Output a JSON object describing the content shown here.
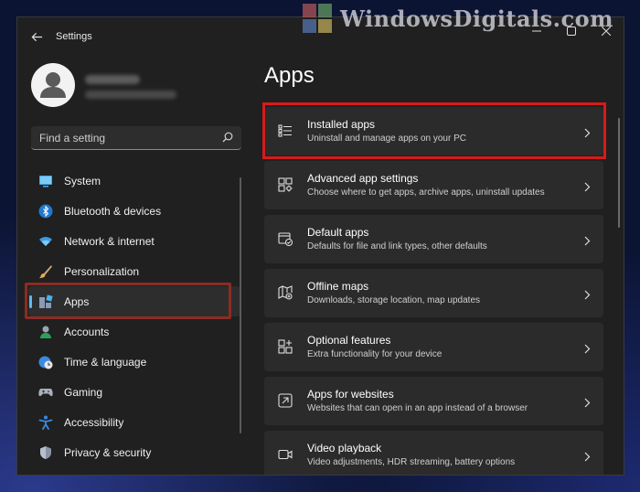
{
  "watermark": {
    "text": "WindowsDigitals.com"
  },
  "window": {
    "title": "Settings"
  },
  "search": {
    "placeholder": "Find a setting"
  },
  "nav": {
    "items": [
      {
        "label": "System",
        "icon": "monitor-icon"
      },
      {
        "label": "Bluetooth & devices",
        "icon": "bluetooth-icon"
      },
      {
        "label": "Network & internet",
        "icon": "wifi-icon"
      },
      {
        "label": "Personalization",
        "icon": "paintbrush-icon"
      },
      {
        "label": "Apps",
        "icon": "apps-icon",
        "active": true
      },
      {
        "label": "Accounts",
        "icon": "person-icon"
      },
      {
        "label": "Time & language",
        "icon": "globe-clock-icon"
      },
      {
        "label": "Gaming",
        "icon": "gamepad-icon"
      },
      {
        "label": "Accessibility",
        "icon": "accessibility-icon"
      },
      {
        "label": "Privacy & security",
        "icon": "shield-icon"
      }
    ]
  },
  "main": {
    "title": "Apps",
    "cards": [
      {
        "title": "Installed apps",
        "desc": "Uninstall and manage apps on your PC",
        "icon": "list-icon"
      },
      {
        "title": "Advanced app settings",
        "desc": "Choose where to get apps, archive apps, uninstall updates",
        "icon": "app-settings-icon"
      },
      {
        "title": "Default apps",
        "desc": "Defaults for file and link types, other defaults",
        "icon": "default-apps-icon"
      },
      {
        "title": "Offline maps",
        "desc": "Downloads, storage location, map updates",
        "icon": "map-icon"
      },
      {
        "title": "Optional features",
        "desc": "Extra functionality for your device",
        "icon": "grid-plus-icon"
      },
      {
        "title": "Apps for websites",
        "desc": "Websites that can open in an app instead of a browser",
        "icon": "open-in-app-icon"
      },
      {
        "title": "Video playback",
        "desc": "Video adjustments, HDR streaming, battery options",
        "icon": "video-icon"
      }
    ]
  },
  "colors": {
    "accent": "#60b8f0",
    "highlight_red": "#d71a1a",
    "highlight_dark_red": "#8b2c24"
  }
}
